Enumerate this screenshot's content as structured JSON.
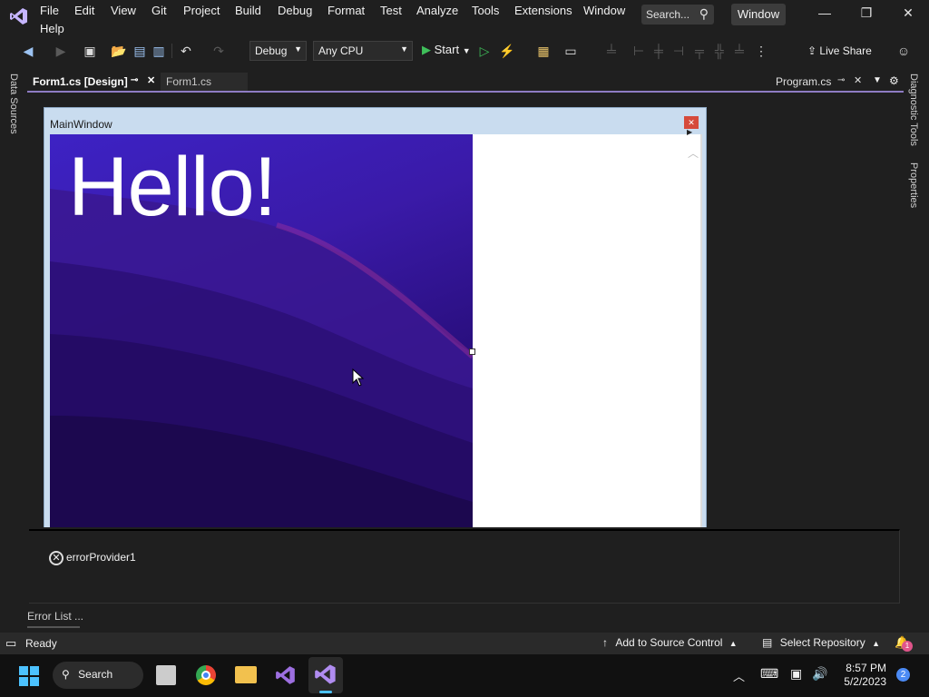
{
  "menu": {
    "items": [
      "File",
      "Edit",
      "View",
      "Git",
      "Project",
      "Build",
      "Debug",
      "Format",
      "Test",
      "Analyze",
      "Tools",
      "Extensions",
      "Window",
      "Help"
    ],
    "search_placeholder": "Search...",
    "window_badge": "Window"
  },
  "toolbar": {
    "config": "Debug",
    "platform": "Any CPU",
    "start_label": "Start",
    "live_share": "Live Share"
  },
  "side_panels": {
    "left": "Data Sources",
    "right_top": "Diagnostic Tools",
    "right_bottom": "Properties"
  },
  "doc_tabs": [
    {
      "label": "Form1.cs [Design]",
      "active": true
    },
    {
      "label": "Form1.cs",
      "active": false
    },
    {
      "label": "Program.cs",
      "active": false
    }
  ],
  "form": {
    "title": "MainWindow",
    "hello_text": "Hello!"
  },
  "tray": {
    "component": "errorProvider1"
  },
  "bottom_panel": {
    "error_list": "Error List ..."
  },
  "statusbar": {
    "ready": "Ready",
    "source_control": "Add to Source Control",
    "repository": "Select Repository",
    "notifications": "1"
  },
  "taskbar": {
    "search": "Search",
    "time": "8:57 PM",
    "date": "5/2/2023",
    "notification_count": "2"
  },
  "colors": {
    "accent": "#8e7cc3",
    "gradient_top": "#3d22c4",
    "gradient_bottom": "#1d0a5c"
  }
}
